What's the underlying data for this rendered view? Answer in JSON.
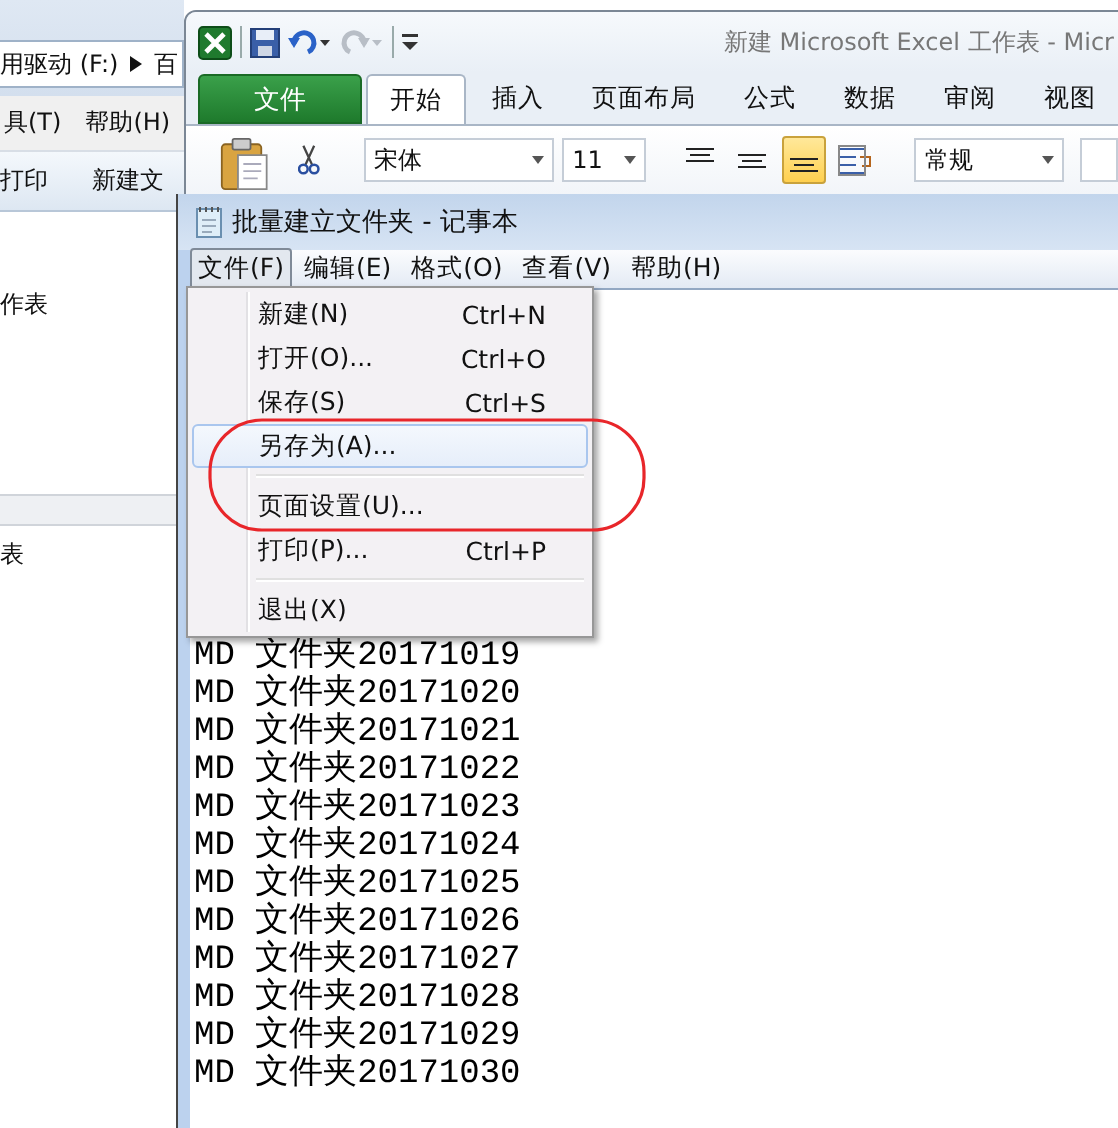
{
  "explorer": {
    "address": "用驱动 (F:)",
    "address_next": "百",
    "menu": [
      {
        "label": "具(T)"
      },
      {
        "label": "帮助(H)"
      }
    ],
    "toolbar": [
      {
        "label": "打印"
      },
      {
        "label": "新建文"
      }
    ],
    "items": [
      {
        "label": "作表"
      },
      {
        "label": "表"
      }
    ]
  },
  "excel": {
    "title": "新建 Microsoft Excel 工作表 - Micr",
    "tabs": [
      {
        "label": "文件",
        "kind": "file"
      },
      {
        "label": "开始",
        "kind": "tab",
        "selected": true
      },
      {
        "label": "插入",
        "kind": "tab",
        "selected": false
      },
      {
        "label": "页面布局",
        "kind": "tab",
        "selected": false
      },
      {
        "label": "公式",
        "kind": "tab",
        "selected": false
      },
      {
        "label": "数据",
        "kind": "tab",
        "selected": false
      },
      {
        "label": "审阅",
        "kind": "tab",
        "selected": false
      },
      {
        "label": "视图",
        "kind": "tab",
        "selected": false
      }
    ],
    "font": "宋体",
    "size": "11",
    "alignment": [
      {
        "kind": "top",
        "selected": false
      },
      {
        "kind": "middle",
        "selected": false
      },
      {
        "kind": "bottom",
        "selected": true
      },
      {
        "kind": "wrap",
        "selected": false
      }
    ],
    "number_format": "常规"
  },
  "notepad": {
    "title": "批量建立文件夹 - 记事本",
    "menu": [
      {
        "label": "文件(F)",
        "selected": true
      },
      {
        "label": "编辑(E)",
        "selected": false
      },
      {
        "label": "格式(O)",
        "selected": false
      },
      {
        "label": "查看(V)",
        "selected": false
      },
      {
        "label": "帮助(H)",
        "selected": false
      }
    ],
    "file_menu": [
      {
        "kind": "item",
        "label": "新建(N)",
        "shortcut": "Ctrl+N",
        "highlighted": false
      },
      {
        "kind": "item",
        "label": "打开(O)...",
        "shortcut": "Ctrl+O",
        "highlighted": false
      },
      {
        "kind": "item",
        "label": "保存(S)",
        "shortcut": "Ctrl+S",
        "highlighted": false
      },
      {
        "kind": "item",
        "label": "另存为(A)...",
        "highlighted": true
      },
      {
        "kind": "separator"
      },
      {
        "kind": "item",
        "label": "页面设置(U)...",
        "highlighted": false
      },
      {
        "kind": "item",
        "label": "打印(P)...",
        "shortcut": "Ctrl+P",
        "highlighted": false
      },
      {
        "kind": "separator"
      },
      {
        "kind": "item",
        "label": "退出(X)",
        "highlighted": false
      }
    ],
    "lines": [
      "MD 文件夹20171019",
      "MD 文件夹20171020",
      "MD 文件夹20171021",
      "MD 文件夹20171022",
      "MD 文件夹20171023",
      "MD 文件夹20171024",
      "MD 文件夹20171025",
      "MD 文件夹20171026",
      "MD 文件夹20171027",
      "MD 文件夹20171028",
      "MD 文件夹20171029",
      "MD 文件夹20171030"
    ]
  },
  "annotation": {
    "kind": "ellipse"
  }
}
